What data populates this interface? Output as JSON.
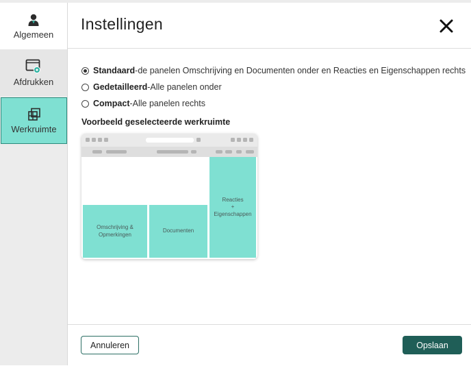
{
  "sidebar": {
    "items": [
      {
        "label": "Algemeen",
        "icon": "user-icon"
      },
      {
        "label": "Afdrukken",
        "icon": "print-settings-icon"
      },
      {
        "label": "Werkruimte",
        "icon": "workspace-icon"
      }
    ],
    "selected": "Werkruimte"
  },
  "header": {
    "title": "Instellingen",
    "close_icon": "close-icon"
  },
  "options": [
    {
      "name": "Standaard",
      "desc": " de panelen Omschrijving en Documenten onder en Reacties en Eigenschappen rechts",
      "selected": true
    },
    {
      "name": "Gedetailleerd",
      "desc": " Alle panelen onder",
      "selected": false
    },
    {
      "name": "Compact",
      "desc": " Alle panelen rechts",
      "selected": false
    }
  ],
  "preview": {
    "title": "Voorbeeld geselecteerde werkruimte",
    "panels": {
      "omschrijving_1": "Omschrijving &",
      "omschrijving_2": "Opmerkingen",
      "documenten": "Documenten",
      "reacties_1": "Reacties",
      "reacties_2": "+",
      "reacties_3": "Eigenschappen"
    }
  },
  "footer": {
    "cancel_label": "Annuleren",
    "save_label": "Opslaan"
  },
  "colors": {
    "accent": "#7fe0d2",
    "primary": "#1f5e57",
    "sidebar_bg": "#ececec"
  }
}
